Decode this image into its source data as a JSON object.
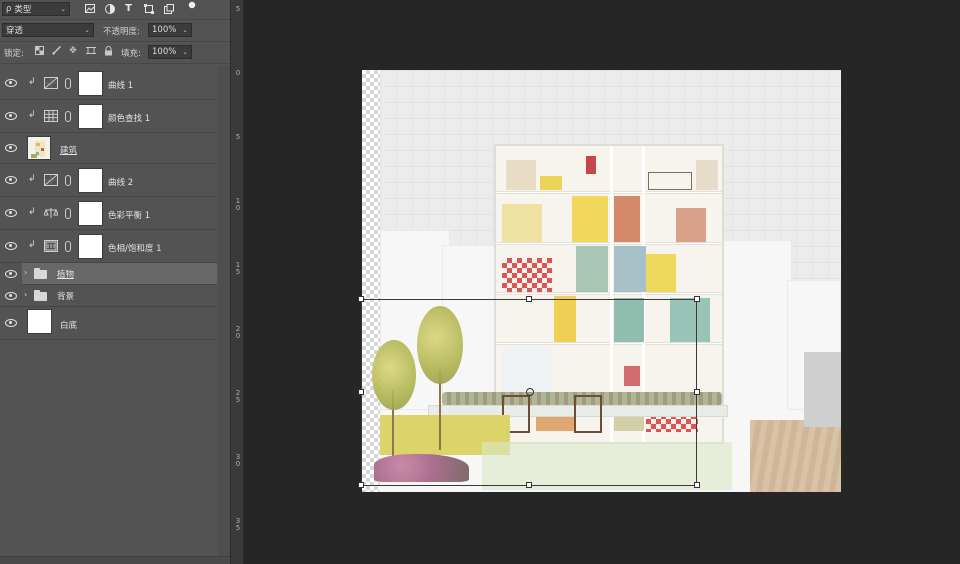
{
  "layers_panel": {
    "filter": {
      "label": "类型",
      "search_glyph": "ρ"
    },
    "filter_icons": [
      "image-filter-icon",
      "adjustment-filter-icon",
      "type-filter-icon",
      "shape-filter-icon",
      "smart-object-filter-icon",
      "filter-toggle-icon"
    ],
    "blend_mode": "穿透",
    "opacity_label": "不透明度:",
    "opacity_value": "100%",
    "lock_label": "锁定:",
    "fill_label": "填充:",
    "fill_value": "100%",
    "layers": [
      {
        "name": "曲线 1",
        "type": "adjustment",
        "icon": "curves-icon",
        "clipped": true
      },
      {
        "name": "颜色查找 1",
        "type": "adjustment",
        "icon": "color-lookup-icon",
        "clipped": true
      },
      {
        "name": "建筑",
        "type": "image",
        "clipped": false
      },
      {
        "name": "曲线 2",
        "type": "adjustment",
        "icon": "curves-icon",
        "clipped": true
      },
      {
        "name": "色彩平衡 1",
        "type": "adjustment",
        "icon": "color-balance-icon",
        "clipped": true
      },
      {
        "name": "色相/饱和度 1",
        "type": "adjustment",
        "icon": "hue-saturation-icon",
        "clipped": true
      },
      {
        "name": "植物",
        "type": "group",
        "selected": true
      },
      {
        "name": "背景",
        "type": "group"
      },
      {
        "name": "白底",
        "type": "fill"
      }
    ]
  },
  "ruler": {
    "labels": [
      "5",
      "0",
      "5",
      "1\n0",
      "1\n5",
      "2\n0",
      "2\n5",
      "3\n0",
      "3\n5"
    ]
  },
  "colors": {
    "panel_bg": "#535353",
    "workspace_bg": "#262626",
    "selected_layer": "#676767"
  }
}
